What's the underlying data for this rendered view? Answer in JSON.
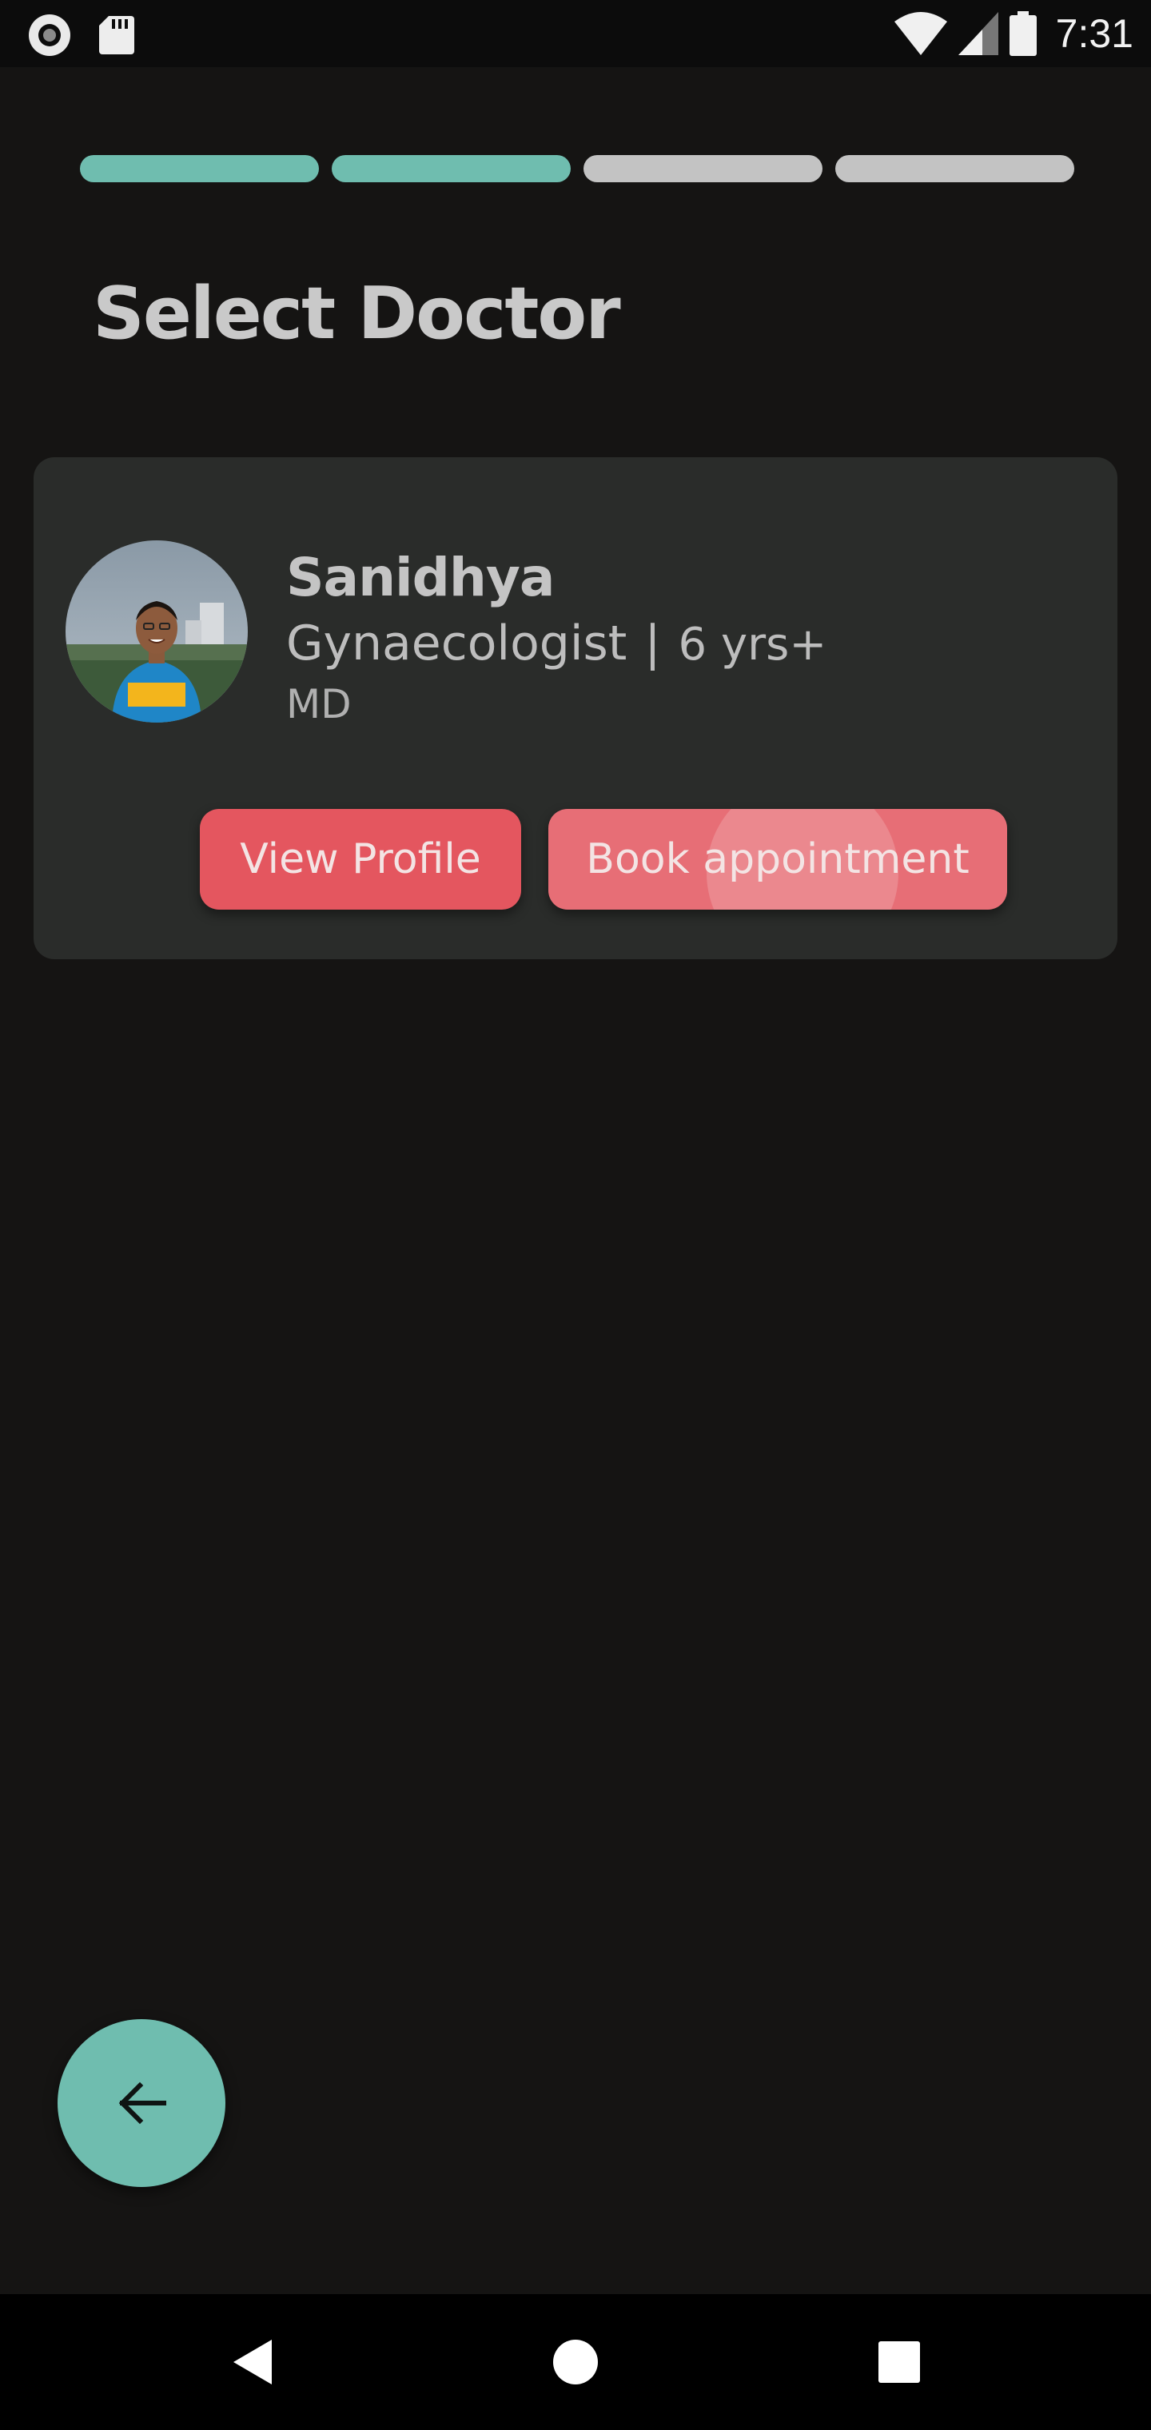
{
  "status_bar": {
    "time": "7:31",
    "icons": [
      "screen-record-icon",
      "sd-card-icon",
      "wifi-icon",
      "cell-signal-icon",
      "battery-icon"
    ]
  },
  "progress": {
    "total_steps": 4,
    "completed_steps": 2,
    "colors": {
      "done": "#6fbdaf",
      "pending": "#c3c3c3"
    }
  },
  "page": {
    "title": "Select Doctor"
  },
  "doctor": {
    "name": "Sanidhya",
    "specialty": "Gynaecologist",
    "separator": "|",
    "experience": "6 yrs+",
    "degree": "MD",
    "avatar_icon": "doctor-photo"
  },
  "actions": {
    "view_profile": "View Profile",
    "book_appointment": "Book appointment"
  },
  "fab": {
    "icon": "arrow-left-icon"
  },
  "nav": {
    "icons": [
      "back-triangle-icon",
      "home-circle-icon",
      "recents-square-icon"
    ]
  },
  "colors": {
    "background": "#151413",
    "card": "#2a2c2a",
    "accent": "#6fbdaf",
    "button_primary": "#e4565f",
    "button_secondary": "#e76e76"
  }
}
